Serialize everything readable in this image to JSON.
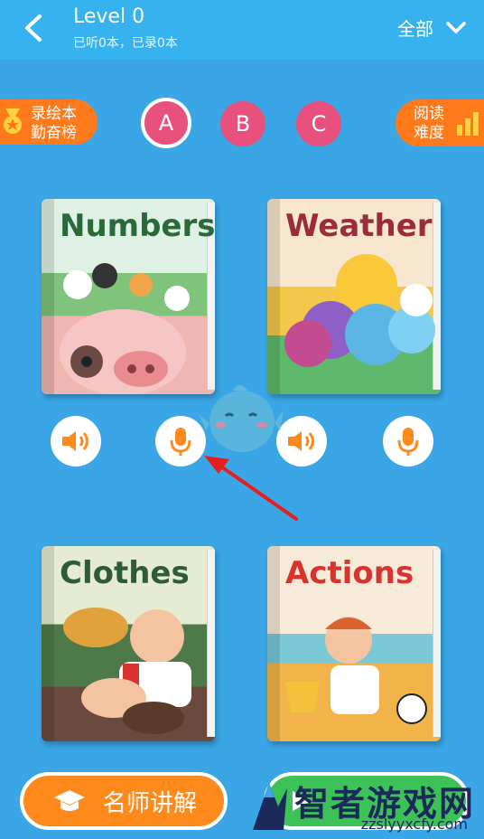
{
  "header": {
    "title": "Level 0",
    "subtitle": "已听0本，已录0本",
    "filter_label": "全部"
  },
  "badges": {
    "left_line1": "录绘本",
    "left_line2": "勤奋榜",
    "right_line1": "阅读",
    "right_line2": "难度"
  },
  "levels": [
    "A",
    "B",
    "C"
  ],
  "books": [
    {
      "title": "Numbers"
    },
    {
      "title": "Weather"
    },
    {
      "title": "Clothes"
    },
    {
      "title": "Actions"
    }
  ],
  "bottom": {
    "teacher_label": "名师讲解"
  },
  "watermark": {
    "brand": "智者游戏网",
    "url": "zzslyyxcfy.com"
  }
}
